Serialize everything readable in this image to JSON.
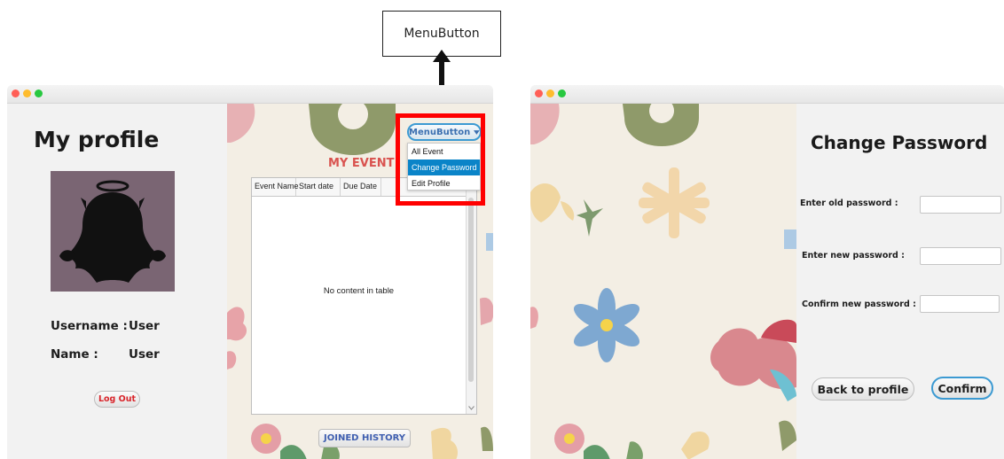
{
  "callout": {
    "label": "MenuButton"
  },
  "profile_window": {
    "title": "My profile",
    "username_label": "Username :",
    "username_value": "User",
    "name_label": "Name :",
    "name_value": "User",
    "logout_label": "Log Out",
    "events_heading": "MY EVENT",
    "table": {
      "columns": [
        "Event Name",
        "Start date",
        "Due Date"
      ],
      "empty_text": "No content in table"
    },
    "joined_history_label": "JOINED HISTORY",
    "menu_button": {
      "label": "MenuButton",
      "items": [
        "All Event",
        "Change Password",
        "Edit Profile"
      ],
      "selected": "Change Password"
    }
  },
  "password_window": {
    "title": "Change Password",
    "old_label": "Enter old password :",
    "new_label": "Enter new password :",
    "confirm_label": "Confirm new password :",
    "old_value": "",
    "new_value": "",
    "confirm_value": "",
    "back_label": "Back to profile",
    "confirm_button": "Confirm"
  },
  "colors": {
    "highlight": "#ff0000",
    "logout_text": "#d9252b",
    "events_heading": "#d9534f",
    "joined_history_text": "#3f5fb0",
    "menu_accent": "#3c9ad2",
    "menu_selected": "#0a84c8",
    "avatar_bg": "#7a6573"
  },
  "icons": [
    "arrow-up-icon",
    "chevron-down-icon",
    "avatar-silhouette-icon",
    "window-close-icon",
    "window-minimize-icon",
    "window-zoom-icon"
  ]
}
